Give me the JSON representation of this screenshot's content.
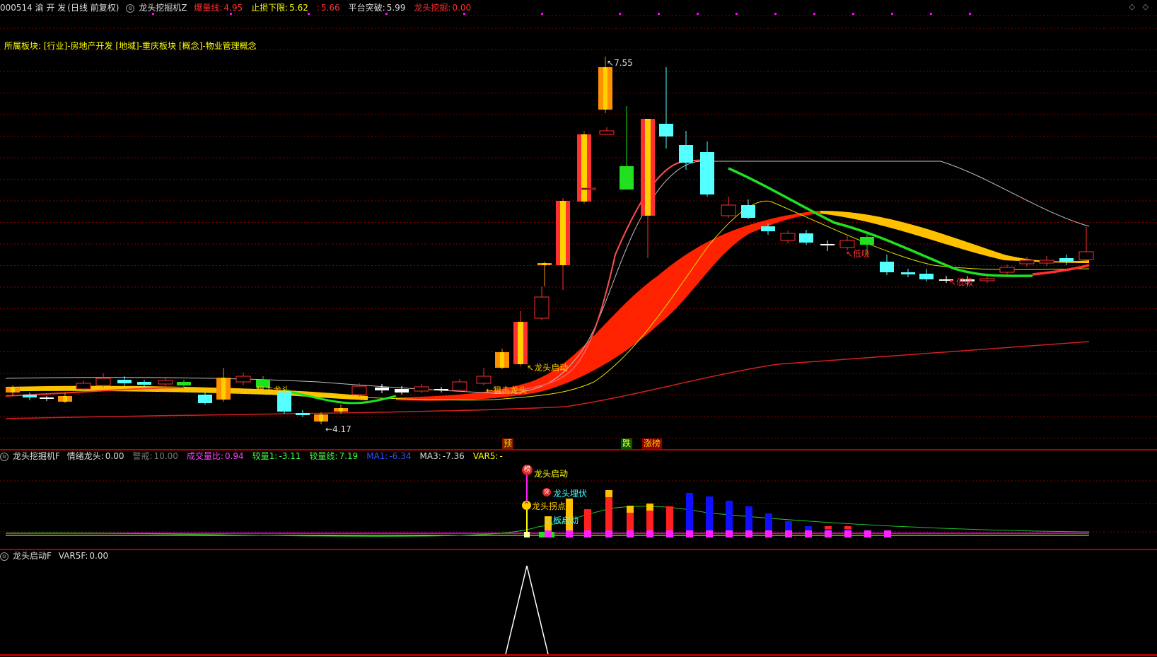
{
  "header": {
    "stock_code_name": "000514 渝 开 发",
    "period": "(日线 前复权)",
    "indicator_name": "龙头挖掘机Z",
    "items": [
      {
        "label": "爆量线:",
        "value": "4.95",
        "label_color": "#ff3030",
        "value_color": "#ff3030"
      },
      {
        "label": "止损下限:",
        "value": "5.62",
        "label_color": "#ffff00",
        "value_color": "#ffff00"
      },
      {
        "label": ":",
        "value": "5.66",
        "label_color": "#ff3030",
        "value_color": "#ff3030"
      },
      {
        "label": "平台突破:",
        "value": "5.99",
        "label_color": "#dddddd",
        "value_color": "#dddddd"
      },
      {
        "label": "龙头挖掘:",
        "value": "0.00",
        "label_color": "#ff3030",
        "value_color": "#ff3030"
      }
    ]
  },
  "sector_info": "所属板块: [行业]-房地产开发 [地域]-重庆板块 [概念]-物业管理概念",
  "main_chart": {
    "high_label": "7.55",
    "low_label": "4.17",
    "annotations": {
      "dragon_start": "龙头启动",
      "ambush_1": "狙击龙头",
      "ambush_2": "狙击龙头",
      "low_buy": "低吸",
      "low_buy_2": "低吸"
    },
    "bottom_tags": {
      "tag1": "预",
      "tag2": "跌",
      "tag3": "涨榜"
    }
  },
  "sub1": {
    "indicator_name": "龙头挖掘机F",
    "items": [
      {
        "label": "情绪龙头:",
        "value": "0.00",
        "color": "#dddddd"
      },
      {
        "label": "警戒:",
        "value": "10.00",
        "color": "#777777"
      },
      {
        "label": "成交量比:",
        "value": "0.94",
        "color": "#ff40ff"
      },
      {
        "label": "较量1:",
        "value": "-3.11",
        "color": "#40ff40"
      },
      {
        "label": "较量线:",
        "value": "7.19",
        "color": "#40ff40"
      },
      {
        "label": "MA1:",
        "value": "-6.34",
        "color": "#3050ff"
      },
      {
        "label": "MA3:",
        "value": "-7.36",
        "color": "#dddddd"
      },
      {
        "label": "VAR5:",
        "value": "-",
        "color": "#ffff00"
      }
    ],
    "annotations": {
      "dragon_start": "龙头启动",
      "dragon_ambush": "龙头埋伏",
      "dragon_turn": "龙头拐点",
      "second_board": "二板启动",
      "badge_char_1": "榜",
      "badge_char_2": "突"
    }
  },
  "sub2": {
    "indicator_name": "龙头启动F",
    "items": [
      {
        "label": "VAR5F:",
        "value": "0.00",
        "color": "#dddddd"
      }
    ]
  },
  "colors": {
    "up": "#ff3030",
    "down": "#54ffff",
    "ribbon_red": "#ff2200",
    "ribbon_yellow": "#ffc000",
    "green_line": "#20e020",
    "grid": "#8a0000"
  }
}
